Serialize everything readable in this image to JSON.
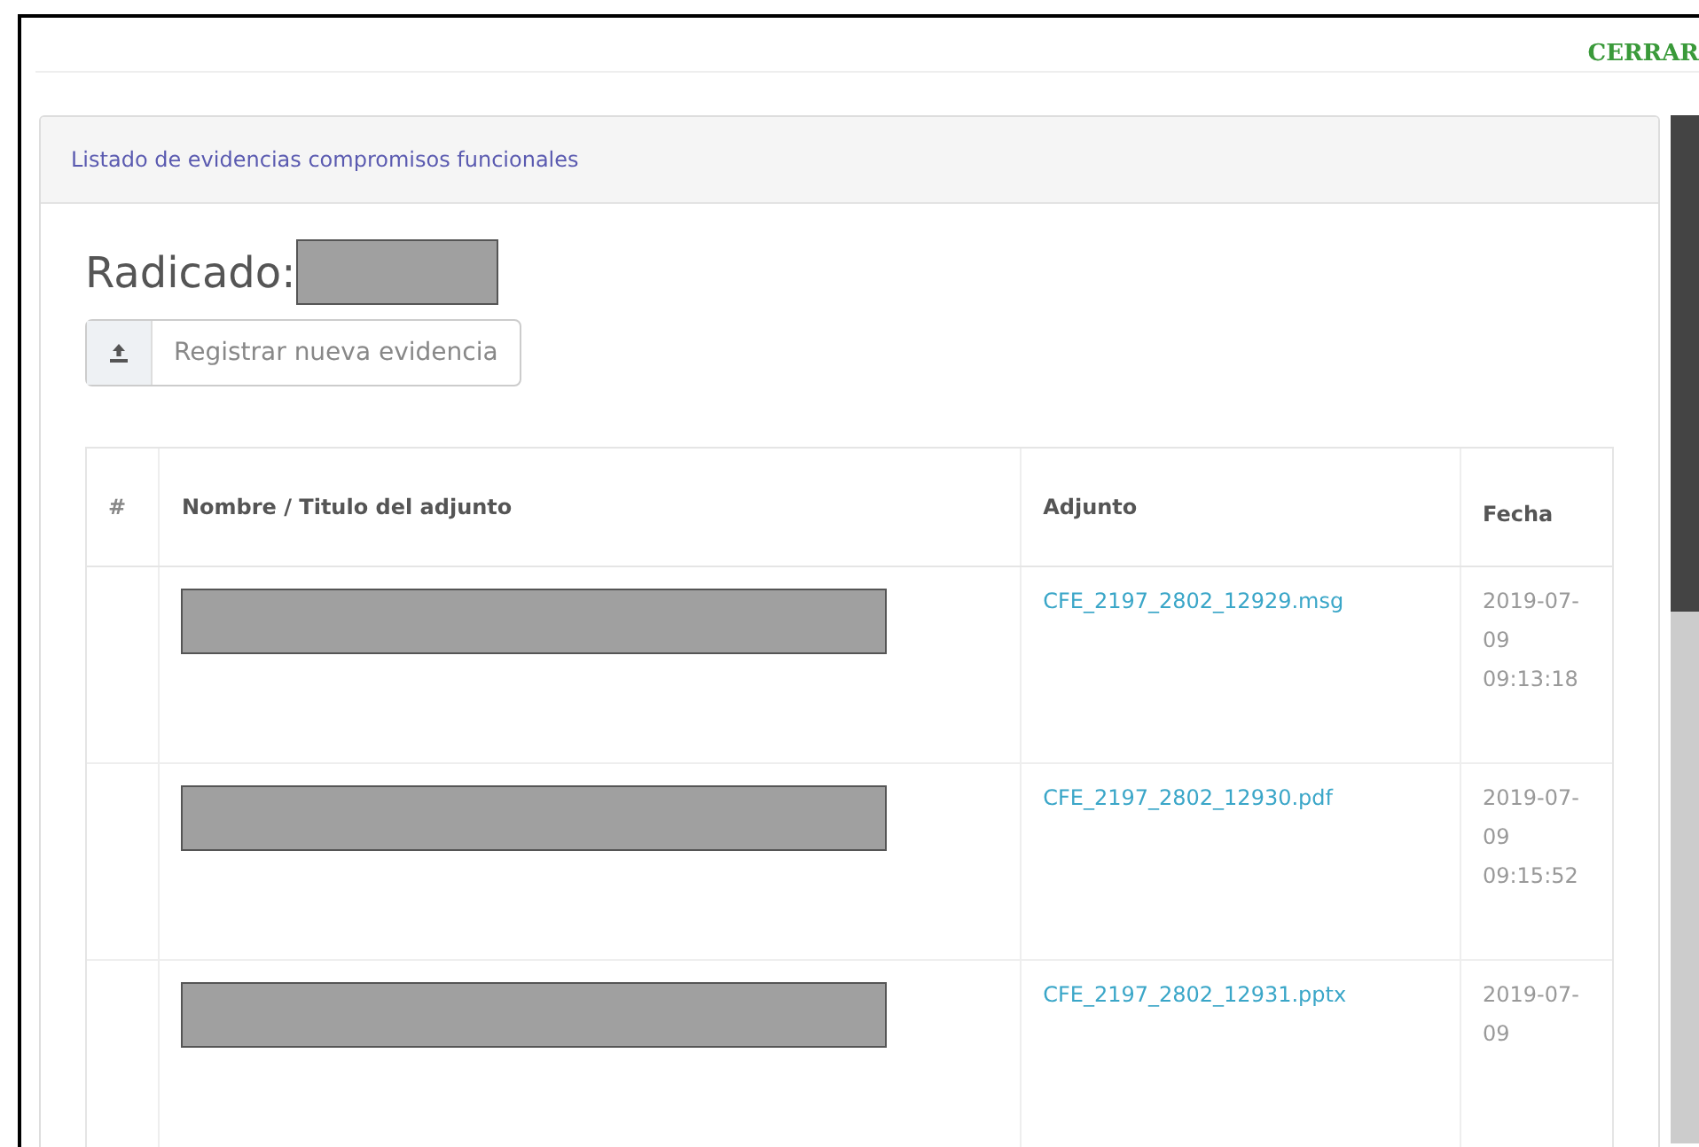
{
  "close_button": "CERRAR",
  "panel": {
    "title": "Listado de evidencias compromisos funcionales",
    "heading": "Radicado:",
    "upload_button": "Registrar nueva evidencia"
  },
  "table": {
    "columns": [
      "#",
      "Nombre / Titulo del adjunto",
      "Adjunto",
      "Fecha"
    ],
    "rows": [
      {
        "attachment": "CFE_2197_2802_12929.msg",
        "date": "2019-07-09 09:13:18"
      },
      {
        "attachment": "CFE_2197_2802_12930.pdf",
        "date": "2019-07-09 09:15:52"
      },
      {
        "attachment": "CFE_2197_2802_12931.pptx",
        "date": "2019-07-09"
      }
    ]
  }
}
